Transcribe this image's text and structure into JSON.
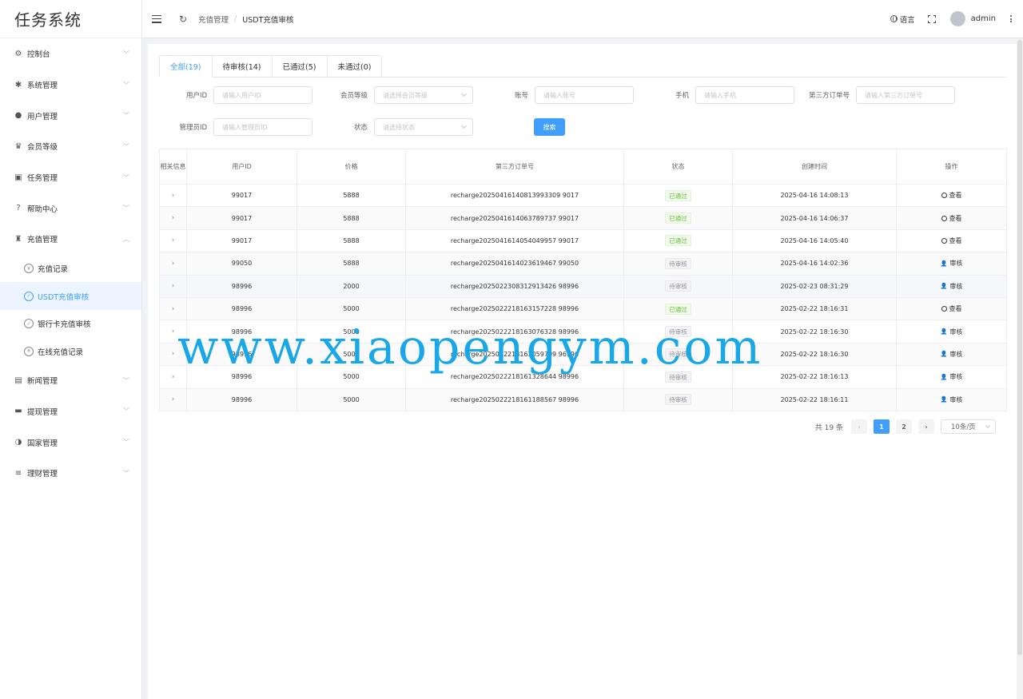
{
  "app": {
    "title": "任务系统"
  },
  "sidebar": {
    "items": [
      {
        "label": "控制台",
        "icon": "dashboard-icon",
        "glyph": "⚙"
      },
      {
        "label": "系统管理",
        "icon": "gear-icon",
        "glyph": "✱"
      },
      {
        "label": "用户管理",
        "icon": "user-icon",
        "glyph": "●"
      },
      {
        "label": "会员等级",
        "icon": "crown-icon",
        "glyph": "♛"
      },
      {
        "label": "任务管理",
        "icon": "clipboard-icon",
        "glyph": "▣"
      },
      {
        "label": "帮助中心",
        "icon": "question-icon",
        "glyph": "?"
      },
      {
        "label": "充值管理",
        "icon": "moneybag-icon",
        "glyph": "♜",
        "expanded": true,
        "children": [
          {
            "label": "充值记录",
            "icon": "yen-circle-icon",
            "glyph": "¥"
          },
          {
            "label": "USDT充值审核",
            "icon": "check-circle-icon",
            "glyph": "✓",
            "active": true
          },
          {
            "label": "银行卡充值审核",
            "icon": "check-circle-icon",
            "glyph": "✓"
          },
          {
            "label": "在线充值记录",
            "icon": "yen-circle-icon",
            "glyph": "¥"
          }
        ]
      },
      {
        "label": "新闻管理",
        "icon": "news-icon",
        "glyph": "▤"
      },
      {
        "label": "提现管理",
        "icon": "wallet-icon",
        "glyph": "▬"
      },
      {
        "label": "国家管理",
        "icon": "globe-icon",
        "glyph": "◑"
      },
      {
        "label": "理财管理",
        "icon": "database-icon",
        "glyph": "≡"
      }
    ]
  },
  "header": {
    "breadcrumb": [
      "充值管理",
      "USDT充值审核"
    ],
    "language_label": "语言",
    "username": "admin"
  },
  "tabs": [
    {
      "label": "全部(19)",
      "active": true
    },
    {
      "label": "待审核(14)"
    },
    {
      "label": "已通过(5)"
    },
    {
      "label": "未通过(0)"
    }
  ],
  "filters": {
    "user_id": {
      "label": "用户ID",
      "placeholder": "请输入用户ID"
    },
    "member_level": {
      "label": "会员等级",
      "placeholder": "请选择会员等级"
    },
    "account": {
      "label": "账号",
      "placeholder": "请输入账号"
    },
    "phone": {
      "label": "手机",
      "placeholder": "请输入手机"
    },
    "third_order": {
      "label": "第三方订单号",
      "placeholder": "请输入第三方订单号"
    },
    "admin_id": {
      "label": "管理员ID",
      "placeholder": "请输入管理员ID"
    },
    "status": {
      "label": "状态",
      "placeholder": "请选择状态"
    },
    "search_button": "搜索"
  },
  "table": {
    "headers": {
      "related": "相关信息",
      "user_id": "用户ID",
      "price": "价格",
      "order_no": "第三方订单号",
      "status": "状态",
      "created": "创建时间",
      "action": "操作"
    },
    "rows": [
      {
        "user_id": "99017",
        "price": "5888",
        "order_no": "recharge20250416140813993309 9017",
        "status": "已通过",
        "status_type": "pass",
        "created": "2025-04-16 14:08:13",
        "action": "查看"
      },
      {
        "user_id": "99017",
        "price": "5888",
        "order_no": "recharge2025041614063789737 99017",
        "status": "已通过",
        "status_type": "pass",
        "created": "2025-04-16 14:06:37",
        "action": "查看"
      },
      {
        "user_id": "99017",
        "price": "5888",
        "order_no": "recharge2025041614054049957 99017",
        "status": "已通过",
        "status_type": "pass",
        "created": "2025-04-16 14:05:40",
        "action": "查看"
      },
      {
        "user_id": "99050",
        "price": "5888",
        "order_no": "recharge2025041614023619467 99050",
        "status": "待审核",
        "status_type": "wait",
        "created": "2025-04-16 14:02:36",
        "action": "审核"
      },
      {
        "user_id": "98996",
        "price": "2000",
        "order_no": "recharge2025022308312913426 98996",
        "status": "待审核",
        "status_type": "wait",
        "created": "2025-02-23 08:31:29",
        "action": "审核"
      },
      {
        "user_id": "98996",
        "price": "5000",
        "order_no": "recharge2025022218163157228 98996",
        "status": "已通过",
        "status_type": "pass",
        "created": "2025-02-22 18:16:31",
        "action": "查看"
      },
      {
        "user_id": "98996",
        "price": "5000",
        "order_no": "recharge2025022218163076328 98996",
        "status": "待审核",
        "status_type": "wait",
        "created": "2025-02-22 18:16:30",
        "action": "审核"
      },
      {
        "user_id": "98996",
        "price": "5000",
        "order_no": "recharge2025022218163059709 96996",
        "status": "待审核",
        "status_type": "wait",
        "created": "2025-02-22 18:16:30",
        "action": "审核"
      },
      {
        "user_id": "98996",
        "price": "5000",
        "order_no": "recharge2025022218161328644 98996",
        "status": "待审核",
        "status_type": "wait",
        "created": "2025-02-22 18:16:13",
        "action": "审核"
      },
      {
        "user_id": "98996",
        "price": "5000",
        "order_no": "recharge2025022218161188567 98996",
        "status": "待审核",
        "status_type": "wait",
        "created": "2025-02-22 18:16:11",
        "action": "审核"
      }
    ]
  },
  "pagination": {
    "total_label": "共 19 条",
    "pages": [
      "1",
      "2"
    ],
    "current": "1",
    "page_size": "10条/页"
  },
  "watermark": "www.xiaopengym.com"
}
